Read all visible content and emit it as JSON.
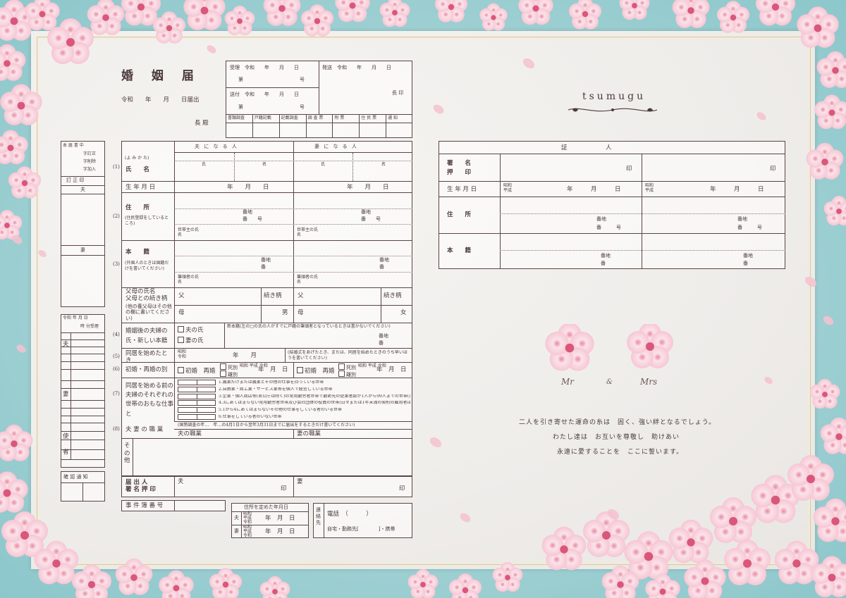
{
  "form": {
    "title": "婚 姻 届",
    "date_line": "令和　　年　　月　　日届出",
    "addressee": "長 殿",
    "office": {
      "receipt": "受理",
      "dispatch": "発送",
      "sent": "送付",
      "era": "令和",
      "ymd": "年　　月　　日",
      "number_prefix": "第",
      "number_suffix": "号",
      "seal_head": "長 印",
      "checks": [
        "書類調査",
        "戸籍記載",
        "記載調査",
        "調 査 票",
        "附 票",
        "住 民 票",
        "通 知"
      ]
    },
    "side": {
      "head1": "本 届 書 中",
      "corr": [
        "字訂正",
        "字削除",
        "字加入"
      ],
      "teisei": "訂 正 印",
      "husband": "夫",
      "wife": "妻",
      "time_label": "令和 年 月 日",
      "ampm": "午前\n午後",
      "time": "時 分受理",
      "confirm": "確 認 通 知",
      "shi": "使",
      "sha": "者"
    },
    "headers": {
      "husband": "夫 に な る 人",
      "wife": "妻 に な る 人"
    },
    "rows": {
      "n1": "(1)",
      "yomikata": "(よ み か た)",
      "name": "氏　　名",
      "uji": "氏",
      "mei": "名",
      "birth": "生 年 月 日",
      "birth_ymd": "年　　月　　日",
      "n2": "(2)",
      "address": "住　　所",
      "address_note": "(住民登録をしているところ)",
      "banchi": "番地",
      "ban": "番",
      "go": "号",
      "householder": "世帯主の氏名",
      "n3": "(3)",
      "honseki": "本　　籍",
      "honseki_note": "(外国人のときは国籍だけを書いてください)",
      "hittousha": "筆頭者の氏名",
      "parents": "父母の氏名\n父母との続き柄",
      "parents_note": "(他の養父母はその他の欄に書いてください)",
      "father": "父",
      "mother": "母",
      "relation": "続き柄",
      "son": "男",
      "daughter": "女",
      "n4": "(4)",
      "new_name": "婚姻後の夫婦の\n氏・新しい本籍",
      "husband_uji": "夫の氏",
      "wife_uji": "妻の氏",
      "new_honseki_note": "新本籍(左の□の氏の人がすでに戸籍の筆頭者となっているときは書かないでください)",
      "n5": "(5)",
      "cohabit_start": "同居を始めたとき",
      "showa_reiwa": "昭和\n令和",
      "ym": "年　　月",
      "cohabit_note": "(結婚式をあげたとき、または、同居を始めたときのうち早いほうを書いてください)",
      "n6": "(6)",
      "first_re": "初婚・再婚の別",
      "first": "初婚",
      "re": "再婚",
      "bereaved": "死別",
      "divorced": "離別",
      "era2": "昭和\n平成\n令和",
      "ymd2": "年　月　日",
      "n7": "(7)",
      "occupation_q": "同居を始める前の夫婦のそれぞれの世帯のおもな仕事と",
      "occupations": [
        "1.農業だけまたは農業とその他の仕事を持っている世帯",
        "2.自由業・商工業・サービス業等を個人で経営している世帯",
        "3.企業・個人商店等(官公庁は除く)の常用勤労者世帯で勤め先の従業者数が1人から99人までの世帯(日々または1年未満の契約の雇用者は5)",
        "4.3にあてはまらない常用勤労者世帯及び会社団体の役員の世帯(日々または1年未満の契約の雇用者は5)",
        "5.1から4にあてはまらないその他の仕事をしている者のいる世帯",
        "6.仕事をしている者のいない世帯"
      ],
      "n8": "(8)",
      "job": "夫 妻 の 職 業",
      "census_note": "(国勢調査の年…　年…の4月1日から翌年3月31日までに届出をするときだけ書いてください)",
      "husband_job": "夫の職業",
      "wife_job": "妻の職業",
      "other": "その他",
      "signer": "届 出 人\n署 名 押 印",
      "seal": "印",
      "case_no": "事 件 簿 番 号",
      "address_date": "住所を定めた年月日",
      "contact": "連絡先",
      "phone": "電話　（　　　）",
      "contact_place": "自宅・勤務先[　　　　]・携帯"
    }
  },
  "right": {
    "brand": "tsumugu",
    "witness": "証　　　　　人",
    "sign": "署　　名\n押　　印",
    "seal": "印",
    "birth": "生 年 月 日",
    "era": "昭和\n平成",
    "ymd": "年　　　月　　　日",
    "address": "住　　所",
    "banchi": "番地",
    "ban": "番",
    "go": "号",
    "honseki": "本　　籍",
    "mr": "Mr",
    "amp": "&",
    "mrs": "Mrs",
    "message": [
      "二人を引き寄せた運命の糸は　固く、強い絆となるでしょう。",
      "わたし達は　お互いを尊敬し　助けあい",
      "永遠に愛することを　ここに誓います。"
    ]
  },
  "colors": {
    "sky": "#9fd4d6",
    "paper": "#f2f0ec",
    "line": "#5a4545",
    "blossom": "#f4c3cf",
    "gold": "#d9c99a"
  }
}
